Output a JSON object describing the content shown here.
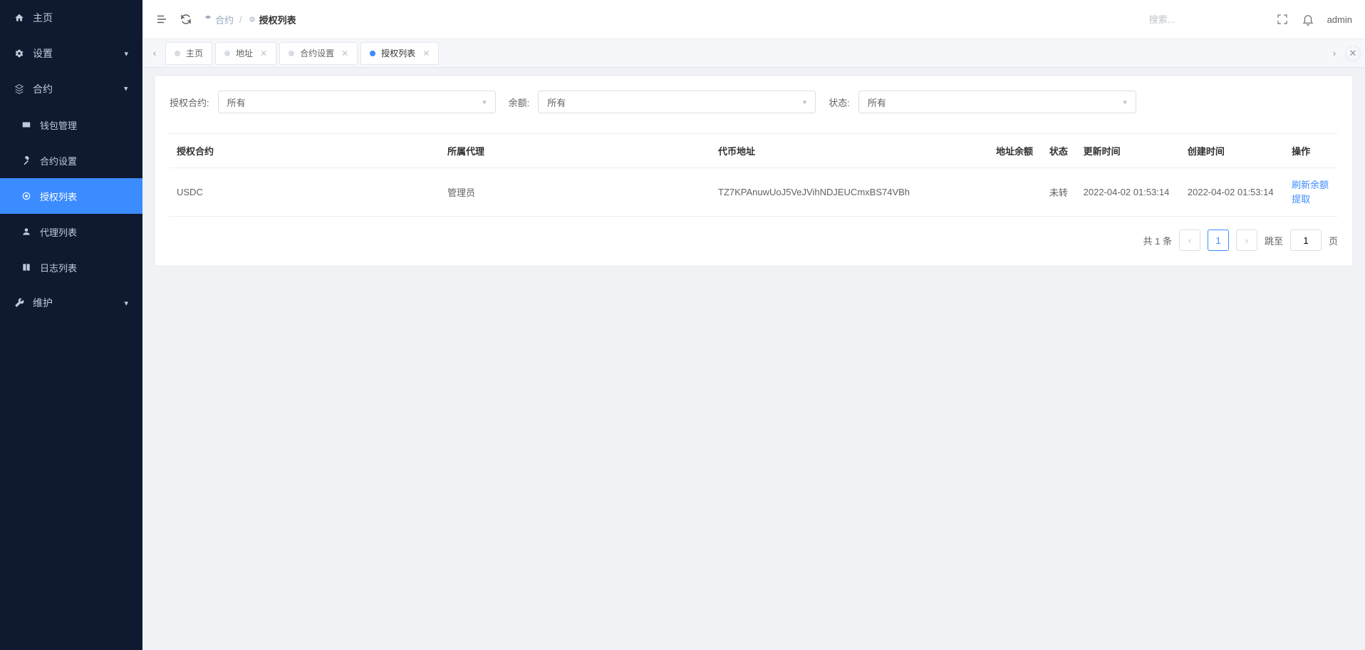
{
  "sidebar": {
    "home": "主页",
    "settings": "设置",
    "contract": "合约",
    "wallet_mgmt": "钱包管理",
    "contract_setup": "合约设置",
    "auth_list": "授权列表",
    "agent_list": "代理列表",
    "log_list": "日志列表",
    "maintenance": "维护"
  },
  "topbar": {
    "breadcrumb_contract": "合约",
    "breadcrumb_current": "授权列表",
    "search_placeholder": "搜索...",
    "user": "admin"
  },
  "tabs": {
    "home": "主页",
    "address": "地址",
    "contract_setup": "合约设置",
    "auth_list": "授权列表"
  },
  "filters": {
    "contract_label": "授权合约:",
    "contract_value": "所有",
    "balance_label": "余额:",
    "balance_value": "所有",
    "status_label": "状态:",
    "status_value": "所有"
  },
  "table": {
    "headers": {
      "auth_contract": "授权合约",
      "agent": "所属代理",
      "token_addr": "代币地址",
      "addr_balance": "地址余额",
      "status": "状态",
      "update_time": "更新时间",
      "create_time": "创建时间",
      "actions": "操作"
    },
    "rows": [
      {
        "auth_contract": "USDC",
        "agent": "管理员",
        "token_addr": "TZ7KPAnuwUoJ5VeJVihNDJEUCmxBS74VBh",
        "addr_balance": "",
        "status": "未转",
        "update_time": "2022-04-02 01:53:14",
        "create_time": "2022-04-02 01:53:14"
      }
    ],
    "action_refresh": "刷新余额",
    "action_withdraw": "提取"
  },
  "pager": {
    "total_prefix": "共",
    "total_count": "1",
    "total_suffix": "条",
    "current": "1",
    "jump_label": "跳至",
    "jump_value": "1",
    "page_suffix": "页"
  }
}
